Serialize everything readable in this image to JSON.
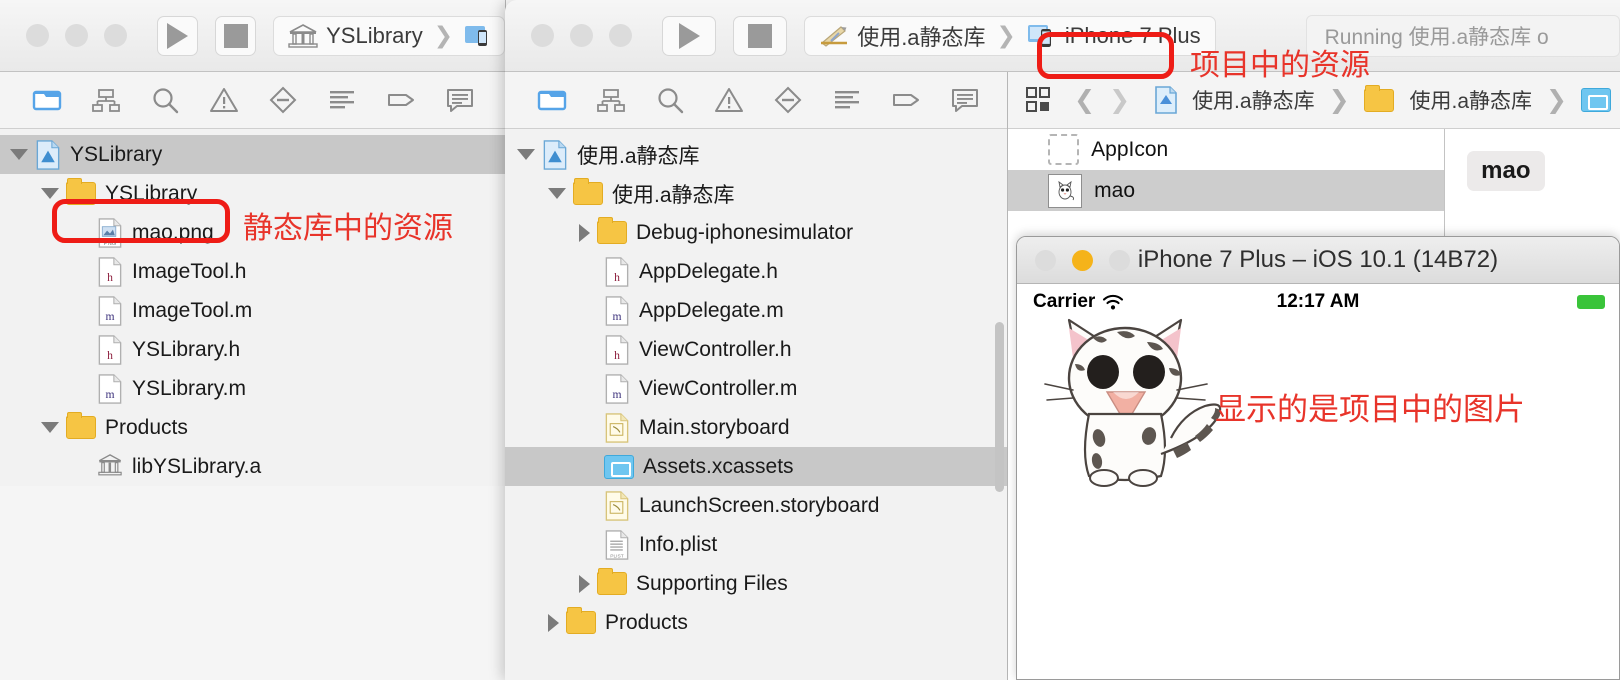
{
  "window_back": {
    "title_scheme": {
      "product": "YSLibrary",
      "icon": "static-library-icon",
      "device_icon": "device-icon"
    },
    "toolbar_buttons": {
      "run": "run-button",
      "stop": "stop-button"
    },
    "navigator_icons": [
      "folder-navigator-icon",
      "hierarchy-navigator-icon",
      "search-navigator-icon",
      "warning-navigator-icon",
      "issue-navigator-icon",
      "test-navigator-icon",
      "tag-navigator-icon",
      "report-navigator-icon"
    ],
    "tree": [
      {
        "label": "YSLibrary",
        "indent": 0,
        "disclosure": "open",
        "icon": "xcode-project-icon",
        "selected": true
      },
      {
        "label": "YSLibrary",
        "indent": 1,
        "disclosure": "open",
        "icon": "folder-icon",
        "selected": false
      },
      {
        "label": "mao.png",
        "indent": 2,
        "disclosure": "none",
        "icon": "png-file-icon",
        "selected": false
      },
      {
        "label": "ImageTool.h",
        "indent": 2,
        "disclosure": "none",
        "icon": "h-file-icon",
        "selected": false
      },
      {
        "label": "ImageTool.m",
        "indent": 2,
        "disclosure": "none",
        "icon": "m-file-icon",
        "selected": false
      },
      {
        "label": "YSLibrary.h",
        "indent": 2,
        "disclosure": "none",
        "icon": "h-file-icon",
        "selected": false
      },
      {
        "label": "YSLibrary.m",
        "indent": 2,
        "disclosure": "none",
        "icon": "m-file-icon",
        "selected": false
      },
      {
        "label": "Products",
        "indent": 1,
        "disclosure": "open",
        "icon": "folder-icon",
        "selected": false
      },
      {
        "label": "libYSLibrary.a",
        "indent": 2,
        "disclosure": "none",
        "icon": "static-library-icon",
        "selected": false
      }
    ],
    "annotation": "静态库中的资源"
  },
  "window_front": {
    "title_scheme": {
      "product": "使用.a静态库",
      "destination": "iPhone 7 Plus",
      "product_icon": "xcode-app-icon",
      "device_icon": "simulator-device-icon"
    },
    "status": "Running 使用.a静态库 o",
    "toolbar_buttons": {
      "run": "run-button",
      "stop": "stop-button"
    },
    "navigator_icons": [
      "folder-navigator-icon",
      "hierarchy-navigator-icon",
      "search-navigator-icon",
      "warning-navigator-icon",
      "issue-navigator-icon",
      "test-navigator-icon",
      "tag-navigator-icon",
      "report-navigator-icon"
    ],
    "tree": [
      {
        "label": "使用.a静态库",
        "indent": 0,
        "disclosure": "open",
        "icon": "xcode-project-icon",
        "selected": false
      },
      {
        "label": "使用.a静态库",
        "indent": 1,
        "disclosure": "open",
        "icon": "folder-icon",
        "selected": false
      },
      {
        "label": "Debug-iphonesimulator",
        "indent": 2,
        "disclosure": "closed",
        "icon": "folder-icon",
        "selected": false
      },
      {
        "label": "AppDelegate.h",
        "indent": 2,
        "disclosure": "none",
        "icon": "h-file-icon",
        "selected": false
      },
      {
        "label": "AppDelegate.m",
        "indent": 2,
        "disclosure": "none",
        "icon": "m-file-icon",
        "selected": false
      },
      {
        "label": "ViewController.h",
        "indent": 2,
        "disclosure": "none",
        "icon": "h-file-icon",
        "selected": false
      },
      {
        "label": "ViewController.m",
        "indent": 2,
        "disclosure": "none",
        "icon": "m-file-icon",
        "selected": false
      },
      {
        "label": "Main.storyboard",
        "indent": 2,
        "disclosure": "none",
        "icon": "storyboard-file-icon",
        "selected": false
      },
      {
        "label": "Assets.xcassets",
        "indent": 2,
        "disclosure": "none",
        "icon": "xcassets-icon",
        "selected": true
      },
      {
        "label": "LaunchScreen.storyboard",
        "indent": 2,
        "disclosure": "none",
        "icon": "storyboard-file-icon",
        "selected": false
      },
      {
        "label": "Info.plist",
        "indent": 2,
        "disclosure": "none",
        "icon": "plist-file-icon",
        "selected": false
      },
      {
        "label": "Supporting Files",
        "indent": 2,
        "disclosure": "closed",
        "icon": "folder-icon",
        "selected": false
      },
      {
        "label": "Products",
        "indent": 1,
        "disclosure": "closed",
        "icon": "folder-icon",
        "selected": false
      }
    ],
    "jumpbar": {
      "related_items_icon": "related-items-icon",
      "back_icon": "chevron-left-icon",
      "forward_icon": "chevron-right-icon",
      "crumbs": [
        {
          "label": "使用.a静态库",
          "icon": "xcode-project-icon"
        },
        {
          "label": "使用.a静态库",
          "icon": "folder-icon"
        },
        {
          "label": "",
          "icon": "xcassets-icon"
        }
      ]
    },
    "asset_list": [
      {
        "label": "AppIcon",
        "icon": "appicon-placeholder-icon",
        "selected": false
      },
      {
        "label": "mao",
        "icon": "mao-thumbnail-icon",
        "selected": true
      }
    ],
    "inspector": {
      "set_name": "mao"
    },
    "annotation": "项目中的资源"
  },
  "simulator": {
    "title": "iPhone 7 Plus – iOS 10.1 (14B72)",
    "status_bar": {
      "carrier": "Carrier",
      "wifi_icon": "wifi-icon",
      "time": "12:17 AM",
      "battery_icon": "battery-icon"
    },
    "content_image": "mao-cat-image",
    "annotation": "显示的是项目中的图片"
  },
  "colors": {
    "annotation_red": "#e8342a",
    "selection_gray": "#c8c8c8",
    "folder_yellow": "#f6c544",
    "xcassets_blue": "#6fc6f0",
    "accent_blue": "#56a4e8"
  }
}
